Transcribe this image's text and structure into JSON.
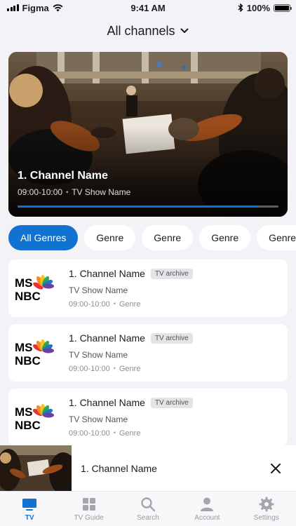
{
  "status_bar": {
    "carrier": "Figma",
    "time": "9:41 AM",
    "battery": "100%"
  },
  "header": {
    "title": "All channels"
  },
  "hero": {
    "title": "1. Channel Name",
    "time": "09:00-10:00",
    "show": "TV Show Name",
    "progress": 0.92
  },
  "genres": [
    "All Genres",
    "Genre",
    "Genre",
    "Genre",
    "Genre"
  ],
  "channels": [
    {
      "logo_top": "MS",
      "logo_bottom": "NBC",
      "name": "1. Channel Name",
      "badge": "TV archive",
      "show": "TV Show Name",
      "time": "09:00-10:00",
      "genre": "Genre"
    },
    {
      "logo_top": "MS",
      "logo_bottom": "NBC",
      "name": "1. Channel Name",
      "badge": "TV archive",
      "show": "TV Show Name",
      "time": "09:00-10:00",
      "genre": "Genre"
    },
    {
      "logo_top": "MS",
      "logo_bottom": "NBC",
      "name": "1. Channel Name",
      "badge": "TV archive",
      "show": "TV Show Name",
      "time": "09:00-10:00",
      "genre": "Genre"
    }
  ],
  "mini_player": {
    "title": "1. Channel Name"
  },
  "tabs": [
    "TV",
    "TV Guide",
    "Search",
    "Account",
    "Settings"
  ],
  "colors": {
    "accent": "#1172d0",
    "background": "#f2f2f7"
  },
  "icons": {
    "signal": "signal-icon",
    "wifi": "wifi-icon",
    "bluetooth": "bluetooth-icon",
    "battery": "battery-icon",
    "chevron": "chevron-down-icon",
    "close": "close-icon",
    "tv": "tv-icon",
    "guide": "grid-icon",
    "search": "search-icon",
    "account": "person-icon",
    "settings": "gear-icon"
  }
}
